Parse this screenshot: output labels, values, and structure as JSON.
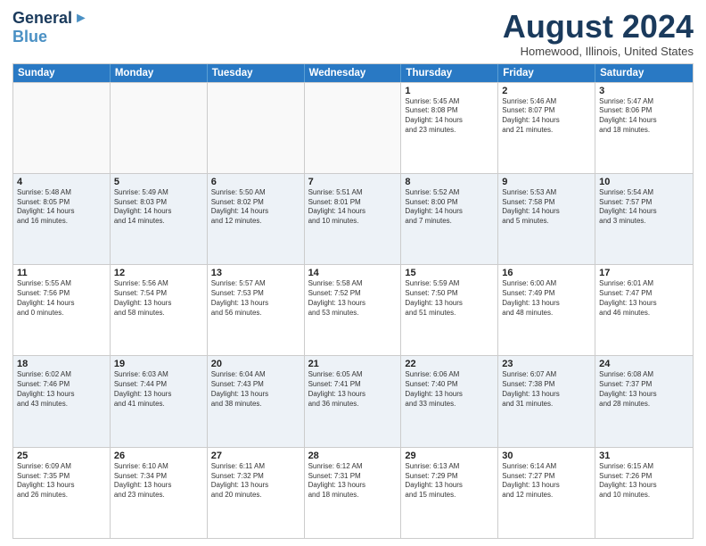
{
  "header": {
    "logo_general": "General",
    "logo_blue": "Blue",
    "month_title": "August 2024",
    "location": "Homewood, Illinois, United States"
  },
  "days_of_week": [
    "Sunday",
    "Monday",
    "Tuesday",
    "Wednesday",
    "Thursday",
    "Friday",
    "Saturday"
  ],
  "rows": [
    {
      "cells": [
        {
          "day": "",
          "info": ""
        },
        {
          "day": "",
          "info": ""
        },
        {
          "day": "",
          "info": ""
        },
        {
          "day": "",
          "info": ""
        },
        {
          "day": "1",
          "info": "Sunrise: 5:45 AM\nSunset: 8:08 PM\nDaylight: 14 hours\nand 23 minutes."
        },
        {
          "day": "2",
          "info": "Sunrise: 5:46 AM\nSunset: 8:07 PM\nDaylight: 14 hours\nand 21 minutes."
        },
        {
          "day": "3",
          "info": "Sunrise: 5:47 AM\nSunset: 8:06 PM\nDaylight: 14 hours\nand 18 minutes."
        }
      ]
    },
    {
      "cells": [
        {
          "day": "4",
          "info": "Sunrise: 5:48 AM\nSunset: 8:05 PM\nDaylight: 14 hours\nand 16 minutes."
        },
        {
          "day": "5",
          "info": "Sunrise: 5:49 AM\nSunset: 8:03 PM\nDaylight: 14 hours\nand 14 minutes."
        },
        {
          "day": "6",
          "info": "Sunrise: 5:50 AM\nSunset: 8:02 PM\nDaylight: 14 hours\nand 12 minutes."
        },
        {
          "day": "7",
          "info": "Sunrise: 5:51 AM\nSunset: 8:01 PM\nDaylight: 14 hours\nand 10 minutes."
        },
        {
          "day": "8",
          "info": "Sunrise: 5:52 AM\nSunset: 8:00 PM\nDaylight: 14 hours\nand 7 minutes."
        },
        {
          "day": "9",
          "info": "Sunrise: 5:53 AM\nSunset: 7:58 PM\nDaylight: 14 hours\nand 5 minutes."
        },
        {
          "day": "10",
          "info": "Sunrise: 5:54 AM\nSunset: 7:57 PM\nDaylight: 14 hours\nand 3 minutes."
        }
      ]
    },
    {
      "cells": [
        {
          "day": "11",
          "info": "Sunrise: 5:55 AM\nSunset: 7:56 PM\nDaylight: 14 hours\nand 0 minutes."
        },
        {
          "day": "12",
          "info": "Sunrise: 5:56 AM\nSunset: 7:54 PM\nDaylight: 13 hours\nand 58 minutes."
        },
        {
          "day": "13",
          "info": "Sunrise: 5:57 AM\nSunset: 7:53 PM\nDaylight: 13 hours\nand 56 minutes."
        },
        {
          "day": "14",
          "info": "Sunrise: 5:58 AM\nSunset: 7:52 PM\nDaylight: 13 hours\nand 53 minutes."
        },
        {
          "day": "15",
          "info": "Sunrise: 5:59 AM\nSunset: 7:50 PM\nDaylight: 13 hours\nand 51 minutes."
        },
        {
          "day": "16",
          "info": "Sunrise: 6:00 AM\nSunset: 7:49 PM\nDaylight: 13 hours\nand 48 minutes."
        },
        {
          "day": "17",
          "info": "Sunrise: 6:01 AM\nSunset: 7:47 PM\nDaylight: 13 hours\nand 46 minutes."
        }
      ]
    },
    {
      "cells": [
        {
          "day": "18",
          "info": "Sunrise: 6:02 AM\nSunset: 7:46 PM\nDaylight: 13 hours\nand 43 minutes."
        },
        {
          "day": "19",
          "info": "Sunrise: 6:03 AM\nSunset: 7:44 PM\nDaylight: 13 hours\nand 41 minutes."
        },
        {
          "day": "20",
          "info": "Sunrise: 6:04 AM\nSunset: 7:43 PM\nDaylight: 13 hours\nand 38 minutes."
        },
        {
          "day": "21",
          "info": "Sunrise: 6:05 AM\nSunset: 7:41 PM\nDaylight: 13 hours\nand 36 minutes."
        },
        {
          "day": "22",
          "info": "Sunrise: 6:06 AM\nSunset: 7:40 PM\nDaylight: 13 hours\nand 33 minutes."
        },
        {
          "day": "23",
          "info": "Sunrise: 6:07 AM\nSunset: 7:38 PM\nDaylight: 13 hours\nand 31 minutes."
        },
        {
          "day": "24",
          "info": "Sunrise: 6:08 AM\nSunset: 7:37 PM\nDaylight: 13 hours\nand 28 minutes."
        }
      ]
    },
    {
      "cells": [
        {
          "day": "25",
          "info": "Sunrise: 6:09 AM\nSunset: 7:35 PM\nDaylight: 13 hours\nand 26 minutes."
        },
        {
          "day": "26",
          "info": "Sunrise: 6:10 AM\nSunset: 7:34 PM\nDaylight: 13 hours\nand 23 minutes."
        },
        {
          "day": "27",
          "info": "Sunrise: 6:11 AM\nSunset: 7:32 PM\nDaylight: 13 hours\nand 20 minutes."
        },
        {
          "day": "28",
          "info": "Sunrise: 6:12 AM\nSunset: 7:31 PM\nDaylight: 13 hours\nand 18 minutes."
        },
        {
          "day": "29",
          "info": "Sunrise: 6:13 AM\nSunset: 7:29 PM\nDaylight: 13 hours\nand 15 minutes."
        },
        {
          "day": "30",
          "info": "Sunrise: 6:14 AM\nSunset: 7:27 PM\nDaylight: 13 hours\nand 12 minutes."
        },
        {
          "day": "31",
          "info": "Sunrise: 6:15 AM\nSunset: 7:26 PM\nDaylight: 13 hours\nand 10 minutes."
        }
      ]
    }
  ]
}
